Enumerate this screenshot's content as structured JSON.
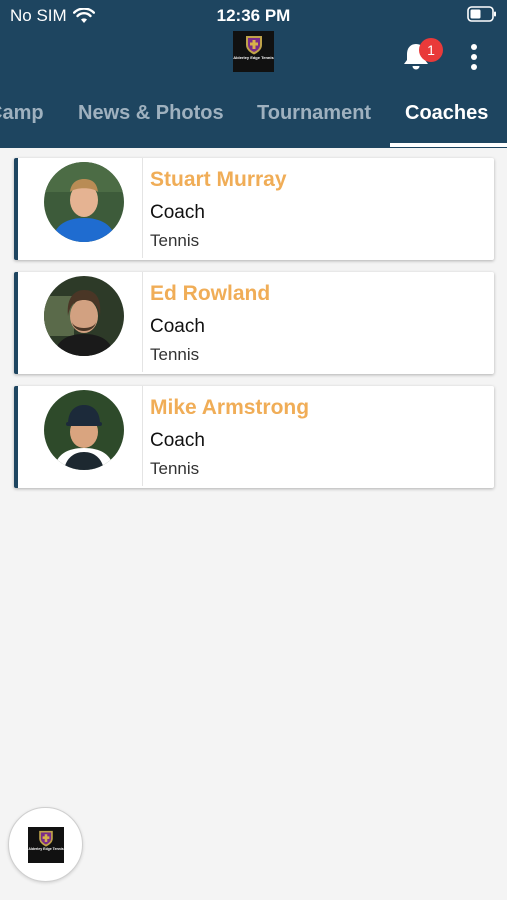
{
  "status_bar": {
    "carrier": "No SIM",
    "time": "12:36 PM",
    "icons": [
      "wifi-icon",
      "battery-icon"
    ]
  },
  "header": {
    "logo_text": "Alderley Edge Tennis",
    "notification_count": "1",
    "icons": [
      "bell-icon",
      "more-vertical-icon"
    ]
  },
  "tabs": [
    {
      "label": "Camp",
      "active": false
    },
    {
      "label": "News & Photos",
      "active": false
    },
    {
      "label": "Tournament",
      "active": false
    },
    {
      "label": "Coaches",
      "active": true
    }
  ],
  "coaches": [
    {
      "name": "Stuart Murray",
      "role": "Coach",
      "sport": "Tennis"
    },
    {
      "name": "Ed Rowland",
      "role": "Coach",
      "sport": "Tennis"
    },
    {
      "name": "Mike Armstrong",
      "role": "Coach",
      "sport": "Tennis"
    }
  ],
  "fab": {
    "logo_text": "Alderley Edge Tennis"
  },
  "colors": {
    "header_bg": "#1e4560",
    "coach_name": "#f0ad57",
    "badge": "#e93a3a",
    "tab_inactive": "#9fb1bf"
  }
}
